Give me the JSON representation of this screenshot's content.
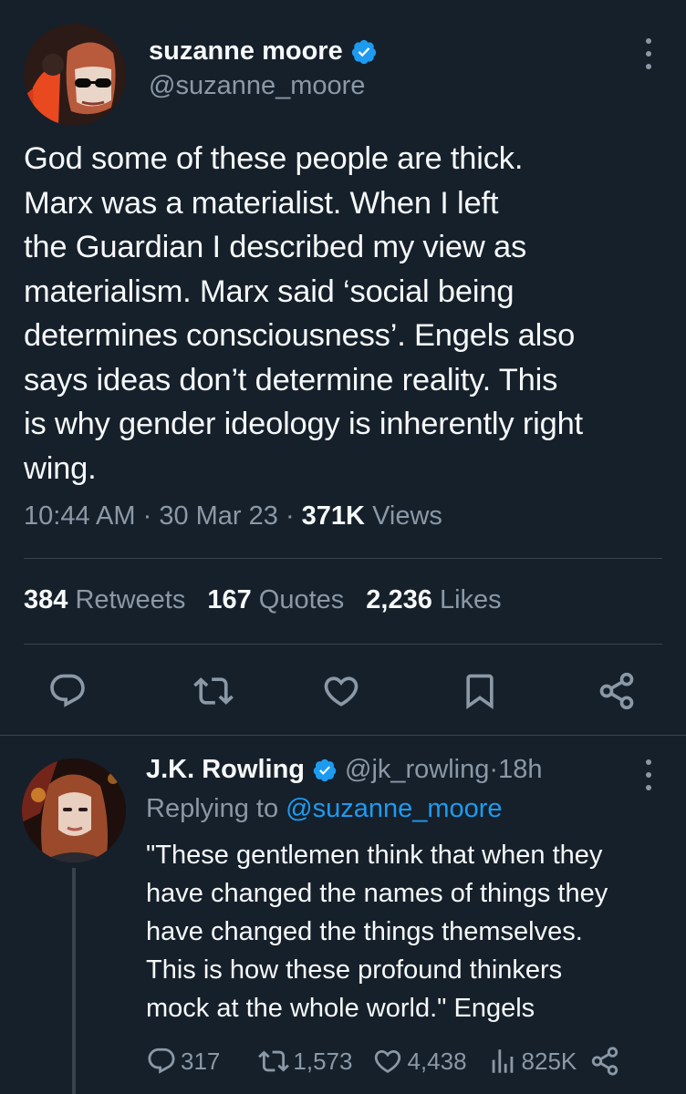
{
  "main_tweet": {
    "author_name": "suzanne moore",
    "author_handle": "@suzanne_moore",
    "text": "God some of these people are thick.\nMarx was a materialist. When I left\nthe Guardian I described my view as\nmaterialism. Marx said ‘social being\ndetermines consciousness’. Engels also\nsays ideas don’t determine reality. This\nis why gender ideology is inherently right\nwing.",
    "time": "10:44 AM",
    "date": "30 Mar 23",
    "views_count": "371K",
    "views_label": "Views",
    "retweets_count": "384",
    "retweets_label": "Retweets",
    "quotes_count": "167",
    "quotes_label": "Quotes",
    "likes_count": "2,236",
    "likes_label": "Likes",
    "actions": [
      "reply-icon",
      "retweet-icon",
      "like-icon",
      "bookmark-icon",
      "share-icon"
    ]
  },
  "reply_tweet": {
    "author_name": "J.K. Rowling",
    "author_handle": "@jk_rowling",
    "time_ago": "18h",
    "replying_prefix": "Replying to",
    "replying_to": "@suzanne_moore",
    "text": "\"These gentlemen think that when they\nhave changed the names of things they\nhave changed the things themselves.\nThis is how these profound thinkers\nmock at the whole world.\" Engels",
    "replies_count": "317",
    "retweets_count": "1,573",
    "likes_count": "4,438",
    "views_count": "825K"
  },
  "colors": {
    "background": "#15202b",
    "text_primary": "#f7f9f9",
    "text_secondary": "#8b98a5",
    "accent": "#1d9bf0",
    "divider": "#38444d"
  }
}
